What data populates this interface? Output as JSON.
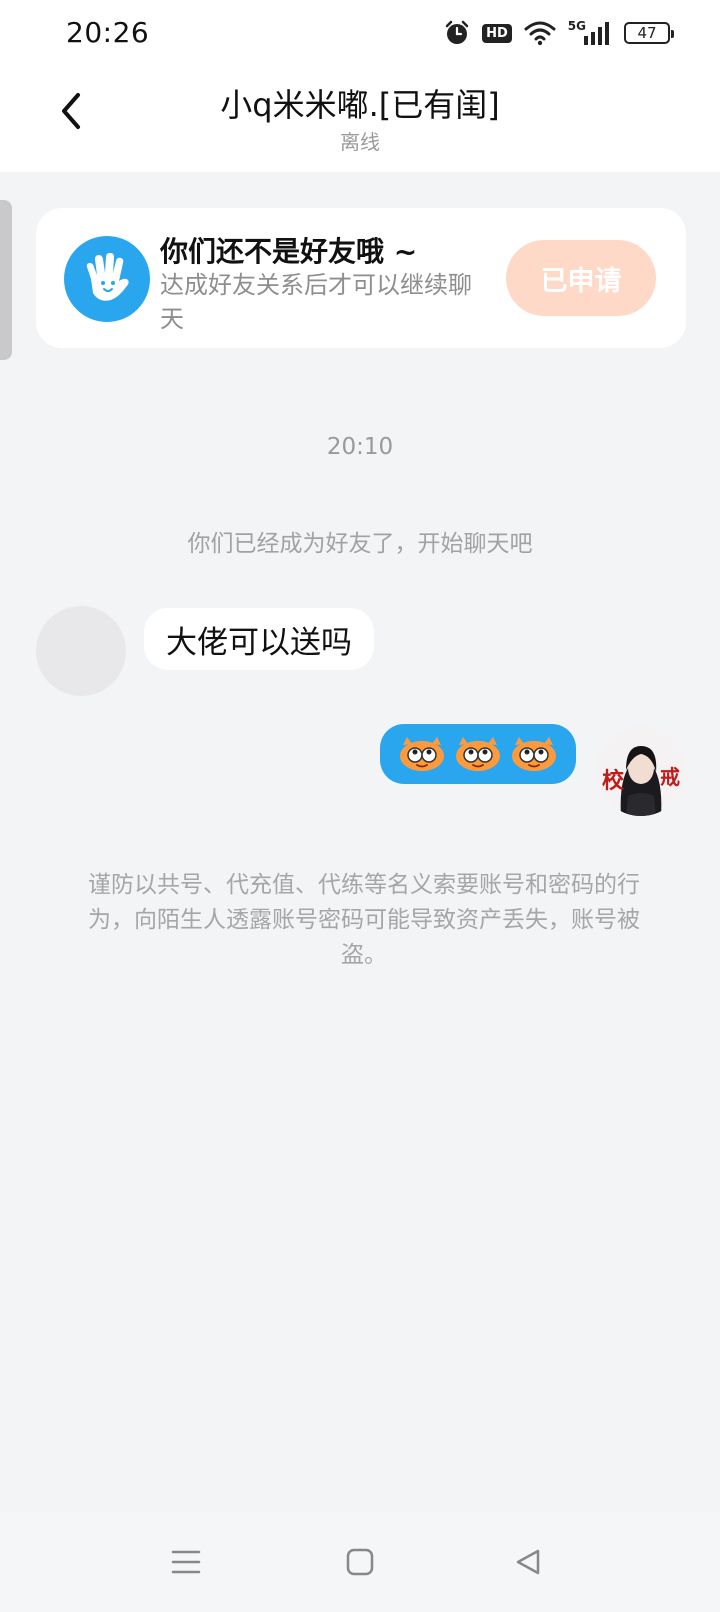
{
  "status_bar": {
    "time": "20:26",
    "hd_label": "HD",
    "network_label": "5G",
    "battery_level": "47",
    "icons": [
      "alarm-icon",
      "hd-icon",
      "wifi-icon",
      "signal-5g-icon",
      "battery-icon"
    ]
  },
  "header": {
    "title": "小q米米嘟.[已有闺]",
    "subtitle": "离线",
    "back_icon": "chevron-left-icon"
  },
  "friend_card": {
    "title": "你们还不是好友哦 ~",
    "description": "达成好友关系后才可以继续聊天",
    "button_label": "已申请",
    "icon": "waving-hand-icon"
  },
  "chat": {
    "timestamp": "20:10",
    "system_message": "你们已经成为好友了，开始聊天吧",
    "messages": [
      {
        "sender": "other",
        "text": "大佬可以送吗"
      },
      {
        "sender": "self",
        "content": "emoji-sticker-row",
        "emoji_count": 3
      }
    ]
  },
  "warning": "谨防以共号、代充值、代练等名义索要账号和密码的行为，向陌生人透露账号密码可能导致资产丢失，账号被盗。",
  "nav": {
    "icons": [
      "menu-icon",
      "home-square-icon",
      "back-triangle-icon"
    ]
  },
  "colors": {
    "accent_blue": "#2aa6ef",
    "applied_button_bg": "#ffd9c7",
    "page_bg": "#f3f4f6"
  }
}
